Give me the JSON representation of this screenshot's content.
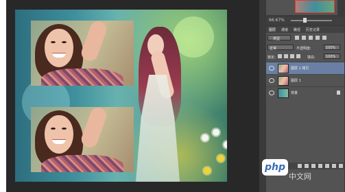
{
  "navigator": {
    "zoom": "66.67%"
  },
  "layers_panel": {
    "tabs": [
      "图层",
      "通道",
      "路径",
      "历史记录"
    ],
    "kind_label": "类型",
    "blend_mode": "正常",
    "opacity_label": "不透明度:",
    "opacity_value": "100%",
    "lock_label": "锁定:",
    "fill_label": "填充:",
    "fill_value": "100%",
    "layers": [
      {
        "name": "图层 1 拷贝",
        "selected": true
      },
      {
        "name": "图层 1",
        "selected": false
      },
      {
        "name": "背景",
        "selected": false
      }
    ]
  },
  "watermark": {
    "logo": "php",
    "site": "中文网"
  }
}
